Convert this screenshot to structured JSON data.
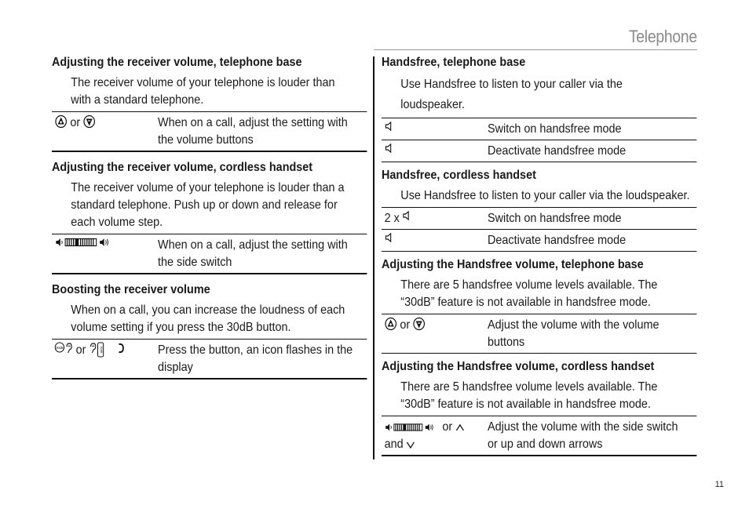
{
  "header": {
    "title": "Telephone"
  },
  "page_number": "11",
  "left": {
    "sections": [
      {
        "title": "Adjusting the receiver volume, telephone base",
        "intro": [
          "The receiver volume of your telephone is louder than",
          "with a standard telephone."
        ],
        "rows": [
          {
            "key_icons": [
              "volume-up-button-icon",
              "volume-down-button-icon"
            ],
            "key_text": "or",
            "value": [
              "When on a call, adjust the setting with",
              "the volume buttons"
            ]
          }
        ]
      },
      {
        "title": "Adjusting the receiver volume, cordless handset",
        "intro": [
          "The receiver volume of your telephone is louder than a",
          "standard telephone. Push up or down and release for",
          "each volume step."
        ],
        "rows": [
          {
            "key_icons": [
              "side-switch-volume-icon"
            ],
            "value": [
              "When on a call, adjust the setting with",
              "the side switch"
            ]
          }
        ]
      },
      {
        "title": "Boosting the receiver volume",
        "intro": [
          "When on a call, you can increase the loudness of each",
          "volume setting if you press the 30dB button."
        ],
        "rows": [
          {
            "key_text": "or",
            "value": [
              "Press the button, an icon flashes in the",
              "display"
            ]
          }
        ]
      }
    ]
  },
  "right": {
    "sections": [
      {
        "title": "Handsfree, telephone base",
        "intro": [
          "Use Handsfree to listen to your caller via the",
          "loudspeaker."
        ],
        "rows": [
          {
            "key_text": "",
            "value": [
              "Switch on handsfree mode"
            ]
          },
          {
            "key_text": "",
            "value": [
              "Deactivate handsfree mode"
            ]
          }
        ]
      },
      {
        "title": "Handsfree, cordless handset",
        "intro": [
          "Use Handsfree to listen to your caller via the loudspeaker."
        ],
        "rows": [
          {
            "key_text": "2 x",
            "value": [
              "Switch on handsfree mode"
            ]
          },
          {
            "key_text": "",
            "value": [
              "Deactivate handsfree  mode"
            ]
          }
        ]
      },
      {
        "title": "Adjusting the Handsfree volume, telephone base",
        "intro": [
          "There are 5 handsfree volume levels available. The",
          "“30dB” feature is not available in handsfree mode."
        ],
        "rows": [
          {
            "key_text": "or",
            "value": [
              "Adjust the volume with the volume",
              "buttons"
            ]
          }
        ]
      },
      {
        "title": "Adjusting the Handsfree volume, cordless handset",
        "intro": [
          "There are 5 handsfree volume levels available.  The",
          "“30dB” feature is not available in handsfree mode."
        ],
        "rows": [
          {
            "key_text": "or",
            "key_text2": "and",
            "value": [
              "Adjust the volume with the side switch",
              "or up and down arrows"
            ]
          }
        ]
      }
    ]
  }
}
